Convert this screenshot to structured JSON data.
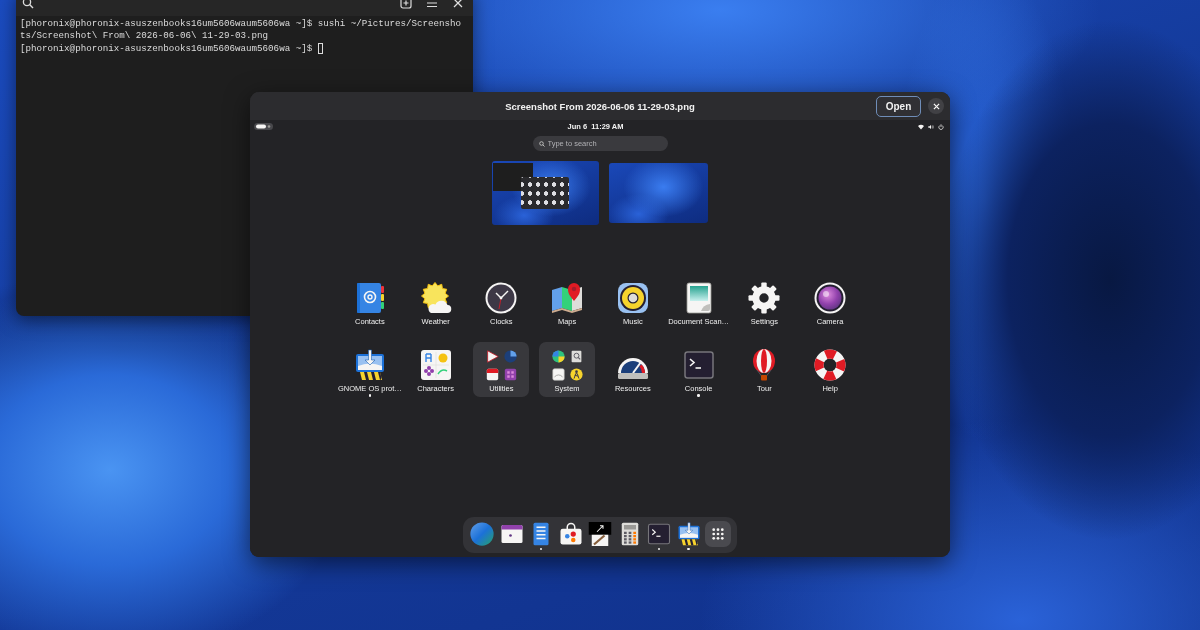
{
  "terminal": {
    "lines": [
      "[phoronix@phoronix-asuszenbooks16um5606waum5606wa ~]$ sushi ~/Pictures/Screensho",
      "ts/Screenshot\\ From\\ 2026-06-06\\ 11-29-03.png",
      "[phoronix@phoronix-asuszenbooks16um5606waum5606wa ~]$"
    ],
    "cursor_visible": true
  },
  "preview": {
    "title": "Screenshot From 2026-06-06 11-29-03.png",
    "open_button": "Open"
  },
  "screenshot": {
    "top_bar": {
      "clock": "Jun 6  11:29 AM"
    },
    "search": {
      "placeholder": "Type to search"
    },
    "workspaces": [
      {
        "kind": "windows"
      },
      {
        "kind": "empty"
      }
    ],
    "apps": [
      {
        "label": "Contacts",
        "kind": "app",
        "running": false
      },
      {
        "label": "Weather",
        "kind": "app",
        "running": false
      },
      {
        "label": "Clocks",
        "kind": "app",
        "running": false
      },
      {
        "label": "Maps",
        "kind": "app",
        "running": false
      },
      {
        "label": "Music",
        "kind": "app",
        "running": false
      },
      {
        "label": "Document Scan…",
        "kind": "app",
        "running": false
      },
      {
        "label": "Settings",
        "kind": "app",
        "running": false
      },
      {
        "label": "Camera",
        "kind": "app",
        "running": false
      },
      {
        "label": "GNOME OS prot…",
        "kind": "app",
        "running": true
      },
      {
        "label": "Characters",
        "kind": "app",
        "running": false
      },
      {
        "label": "Utilities",
        "kind": "folder",
        "running": false
      },
      {
        "label": "System",
        "kind": "folder",
        "running": false
      },
      {
        "label": "Resources",
        "kind": "app",
        "running": false
      },
      {
        "label": "Console",
        "kind": "app",
        "running": true
      },
      {
        "label": "Tour",
        "kind": "app",
        "running": false
      },
      {
        "label": "Help",
        "kind": "app",
        "running": false
      }
    ],
    "dock": [
      {
        "kind": "app",
        "running": false
      },
      {
        "kind": "app",
        "running": false
      },
      {
        "kind": "app",
        "running": true
      },
      {
        "kind": "app",
        "running": false
      },
      {
        "kind": "app",
        "running": false
      },
      {
        "kind": "app",
        "running": false
      },
      {
        "kind": "app",
        "running": true
      },
      {
        "kind": "app",
        "running": true
      },
      {
        "kind": "show-apps",
        "running": false
      }
    ]
  }
}
